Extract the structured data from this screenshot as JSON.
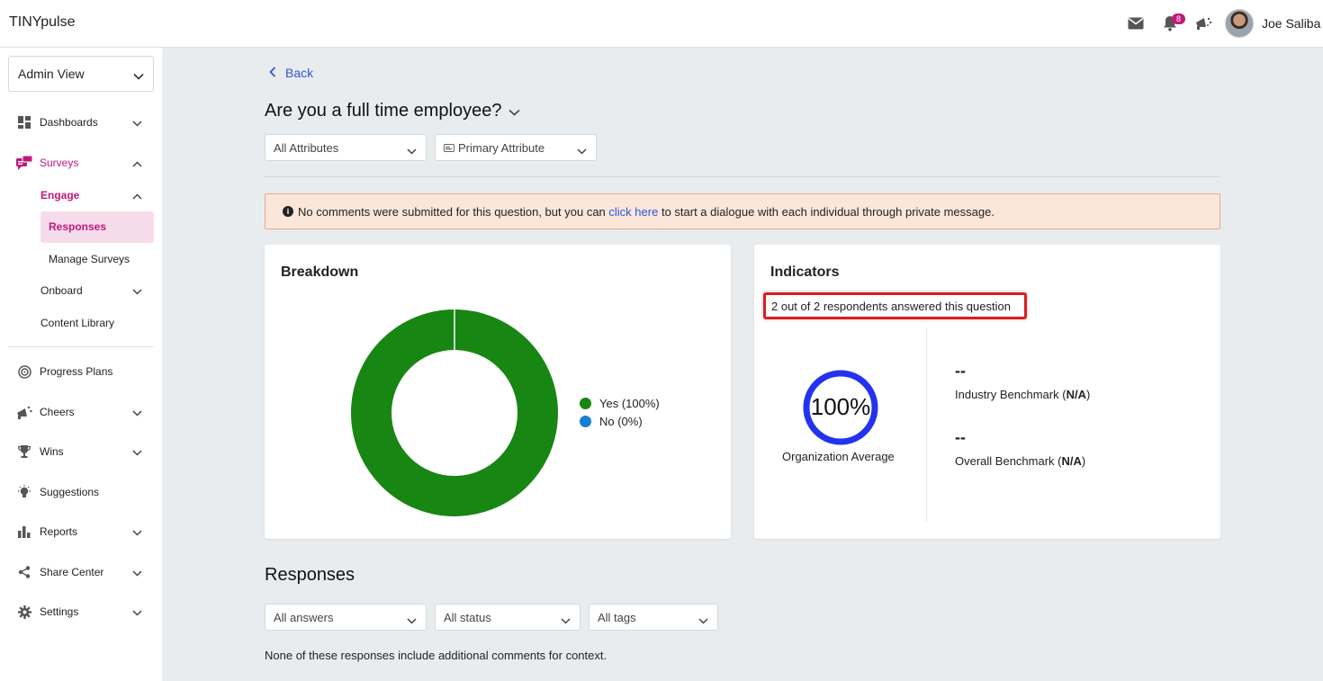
{
  "header": {
    "brand": "TINYpulse",
    "notification_count": "8",
    "user_name": "Joe Saliba"
  },
  "sidebar": {
    "view_select": "Admin View",
    "items": [
      {
        "label": "Dashboards",
        "icon": "dashboard-icon"
      },
      {
        "label": "Surveys",
        "icon": "survey-icon"
      },
      {
        "label": "Progress Plans",
        "icon": "target-icon"
      },
      {
        "label": "Cheers",
        "icon": "megaphone-icon"
      },
      {
        "label": "Wins",
        "icon": "trophy-icon"
      },
      {
        "label": "Suggestions",
        "icon": "lightbulb-icon"
      },
      {
        "label": "Reports",
        "icon": "bar-chart-icon"
      },
      {
        "label": "Share Center",
        "icon": "share-icon"
      },
      {
        "label": "Settings",
        "icon": "gear-icon"
      }
    ],
    "engage": "Engage",
    "responses": "Responses",
    "manage_surveys": "Manage Surveys",
    "onboard": "Onboard",
    "content_library": "Content Library"
  },
  "main": {
    "back": "Back",
    "question": "Are you a full time employee?",
    "filter_attributes": "All Attributes",
    "filter_primary": "Primary Attribute",
    "alert_prefix": "No comments were submitted for this question, but you can",
    "alert_link": "click here",
    "alert_suffix": "to start a dialogue with each individual through private message."
  },
  "breakdown": {
    "title": "Breakdown",
    "legend_yes": "Yes (100%)",
    "legend_no": "No (0%)"
  },
  "chart_data": {
    "type": "pie",
    "categories": [
      "Yes",
      "No"
    ],
    "values": [
      100,
      0
    ],
    "colors": [
      "#188613",
      "#1a7fd0"
    ]
  },
  "indicators": {
    "title": "Indicators",
    "respondents": "2 out of 2 respondents answered this question",
    "org_value": "100%",
    "org_fraction": 1.0,
    "org_label": "Organization Average",
    "industry_value": "--",
    "industry_label": "Industry Benchmark",
    "industry_na": "N/A",
    "overall_value": "--",
    "overall_label": "Overall Benchmark",
    "overall_na": "N/A"
  },
  "responses": {
    "title": "Responses",
    "filter_answers": "All answers",
    "filter_status": "All status",
    "filter_tags": "All tags",
    "empty_text": "None of these responses include additional comments for context."
  },
  "colors": {
    "accent": "#c2187b",
    "link": "#2e55d9",
    "yes": "#188613",
    "no": "#1a7fd0",
    "ring": "#2233ee"
  }
}
